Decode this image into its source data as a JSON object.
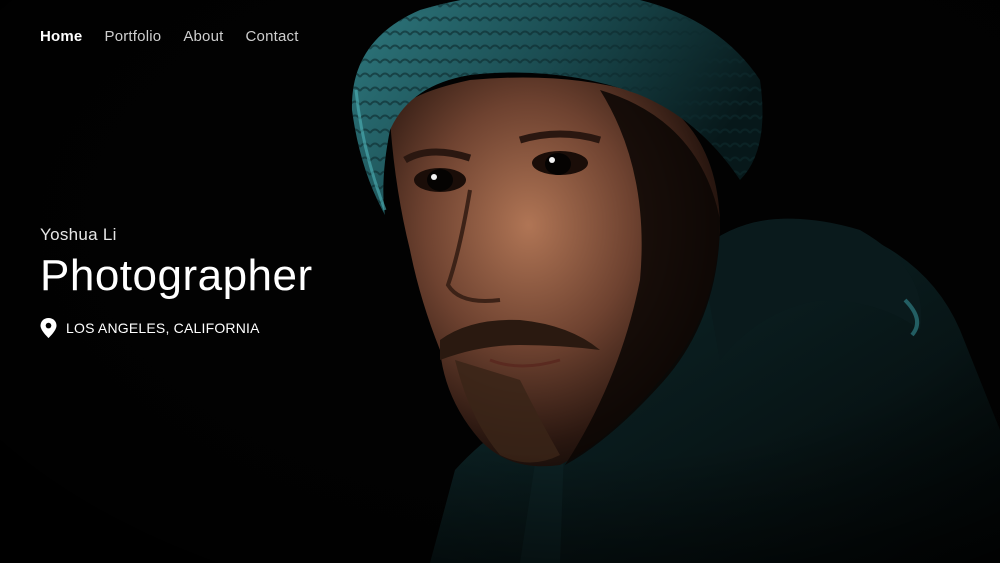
{
  "nav": {
    "items": [
      {
        "label": "Home",
        "active": true
      },
      {
        "label": "Portfolio",
        "active": false
      },
      {
        "label": "About",
        "active": false
      },
      {
        "label": "Contact",
        "active": false
      }
    ]
  },
  "hero": {
    "name": "Yoshua Li",
    "role": "Photographer",
    "location": "LOS ANGELES, CALIFORNIA",
    "location_icon": "map-pin-icon",
    "photo_subject": "portrait of man in teal knit beanie"
  },
  "colors": {
    "background": "#000000",
    "text": "#ffffff",
    "nav_inactive": "#cfcfcf",
    "beanie": "#1f5a5e",
    "skin": "#8a5a3e"
  }
}
